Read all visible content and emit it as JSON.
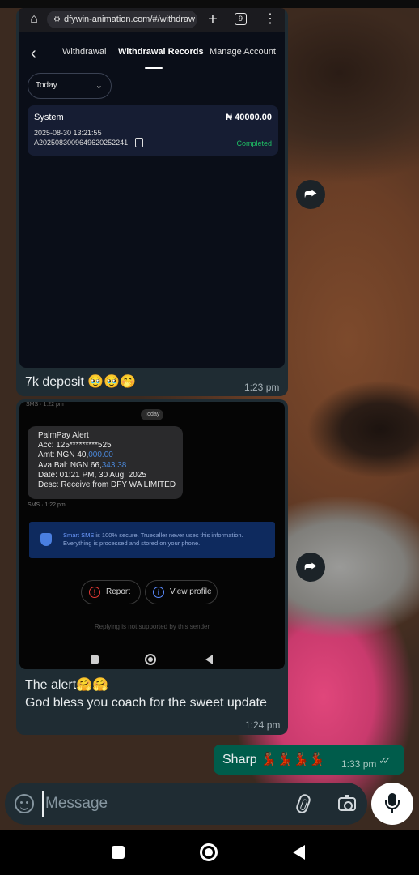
{
  "browser": {
    "url": "dfywin-animation.com/#/withdraw",
    "tab_count": "9"
  },
  "app_tabs": {
    "withdrawal": "Withdrawal",
    "records": "Withdrawal Records",
    "manage": "Manage Account"
  },
  "date_filter": "Today",
  "record": {
    "source": "System",
    "amount": "₦ 40000.00",
    "datetime": "2025-08-30 13:21:55",
    "order_id": "A202508300964962025224​1",
    "status": "Completed"
  },
  "message1": {
    "caption": "7k deposit 🥹🥹🤭",
    "time": "1:23 pm"
  },
  "sms": {
    "header": "SMS · 1:22 pm",
    "date_chip": "Today",
    "lines": {
      "l1": "PalmPay Alert",
      "l2": "Acc: 125*********525",
      "l3a": "Amt: NGN 40,",
      "l3b": "000.00",
      "l4a": "Ava Bal: NGN 66,",
      "l4b": "343.38",
      "l5": "Date: 01:21 PM, 30 Aug, 2025",
      "l6": "Desc: Receive from DFY WA LIMITED"
    },
    "meta": "SMS · 1:22 pm",
    "secure_title": "Smart SMS",
    "secure_text": " is 100% secure. Truecaller never uses this information. Everything is processed and stored on your phone.",
    "report": "Report",
    "view_profile": "View profile",
    "reply_note": "Replying is not supported by this sender"
  },
  "message2": {
    "line1": "The alert🤗🤗",
    "line2": "God bless you coach for the sweet update",
    "time": "1:24 pm"
  },
  "outgoing": {
    "text": "Sharp 💃🏾💃🏾💃🏾💃🏾",
    "time": "1:33 pm",
    "ticks": "✓✓"
  },
  "composer": {
    "placeholder": "Message"
  },
  "colors": {
    "incoming_bubble": "#1f2c33",
    "outgoing_bubble": "#005c4b",
    "status_green": "#1fbf65",
    "link_blue": "#4a86d6"
  },
  "icons": {
    "home": "home-icon",
    "forward": "forward-icon",
    "emoji": "emoji-icon",
    "attach": "paperclip-icon",
    "camera": "camera-icon",
    "mic": "mic-icon"
  }
}
